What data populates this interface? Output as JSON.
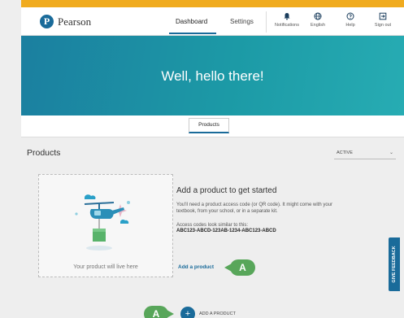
{
  "brand": {
    "logo_letter": "P",
    "name": "Pearson"
  },
  "nav": {
    "tabs": [
      {
        "label": "Dashboard",
        "active": true
      },
      {
        "label": "Settings",
        "active": false
      }
    ],
    "tools": [
      {
        "label": "Notifications",
        "icon": "bell-icon"
      },
      {
        "label": "English",
        "icon": "globe-icon"
      },
      {
        "label": "Help",
        "icon": "help-icon"
      },
      {
        "label": "Sign out",
        "icon": "sign-out-icon"
      }
    ]
  },
  "hero": {
    "title": "Well, hello there!"
  },
  "tabs": {
    "products": "Products"
  },
  "products": {
    "heading": "Products",
    "filter": {
      "selected": "ACTIVE",
      "chevron": "⌄"
    },
    "empty": {
      "placeholder": "Your product will live here",
      "title": "Add a product to get started",
      "description": "You'll need a product access code (or QR code). It might come with your textbook, from your school, or in a separate kit.",
      "codes_label": "Access codes look similar to this:",
      "codes_example": "ABC123-ABCD-123AB-1234-ABC123-ABCD",
      "add_link": "Add a product"
    },
    "add_button": {
      "icon": "+",
      "label": "ADD A PRODUCT"
    }
  },
  "annotations": {
    "callout_1": "A",
    "callout_2": "A"
  },
  "feedback": {
    "label": "GIVE FEEDBACK"
  },
  "colors": {
    "frame": "#f0ab1f",
    "brand_blue": "#1a6b9a",
    "hero_teal": "#1c9aa6",
    "callout_green": "#58a65a"
  }
}
